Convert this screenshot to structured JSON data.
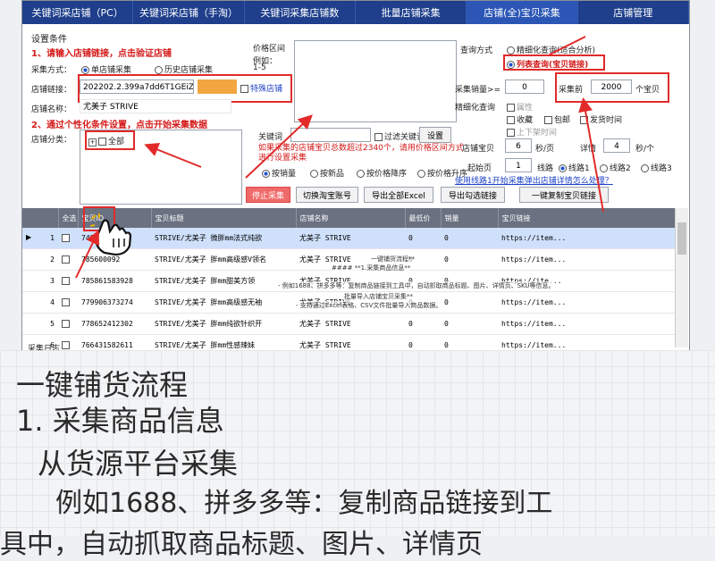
{
  "tabs": [
    "关键词采店铺（PC）",
    "关键词采店铺（手淘）",
    "关键词采集店铺数",
    "批量店铺采集",
    "店铺(全)宝贝采集",
    "店铺管理"
  ],
  "settings": {
    "title": "设置条件",
    "step1": "1、请输入店铺链接，点击验证店铺",
    "collect_method_label": "采集方式：",
    "single_shop": "单店铺采集",
    "history_shop": "历史店铺采集",
    "shop_link_label": "店铺链接：",
    "shop_link_value": "202202.2.399a7dd6T1GEiZ#/",
    "special_shop": "特殊店铺",
    "shop_name_label": "店铺名称：",
    "shop_name_value": "尤美子 STRIVE",
    "step2": "2、通过个性化条件设置，点击开始采集数据",
    "category_label": "店铺分类：",
    "category_all": "全部"
  },
  "price": {
    "label": "价格区间",
    "example": "例如：",
    "example_value": "1-5"
  },
  "keyword": {
    "label": "关键词",
    "filter": "过滤关键词",
    "set": "设置"
  },
  "warning": "如果采集的店铺宝贝总数超过2340个，请用价格区间方式进行设置采集",
  "sort": [
    "按销量",
    "按新品",
    "按价格降序",
    "按价格升序"
  ],
  "buttons": {
    "stop": "停止采集",
    "switch": "切换淘宝账号",
    "export_all": "导出全部Excel",
    "export_selected": "导出勾选链接",
    "copy_links": "一键复制宝贝链接"
  },
  "query": {
    "label": "查询方式",
    "fine": "精细化查询(适合分析)",
    "list": "列表查询(宝贝链接)",
    "volume_label": "采集销量>=",
    "volume_value": "0",
    "collect_before": "采集前",
    "collect_count": "2000",
    "unit": "个宝贝",
    "fine_label": "精细化查询",
    "attr": "属性",
    "favorite": "收藏",
    "free_ship": "包邮",
    "ship_time": "发货时间",
    "online": "上下架时间",
    "shop_baby": "店铺宝贝",
    "shop_baby_value": "6",
    "per_page": "秒/页",
    "detail": "详情",
    "detail_value": "4",
    "per_item": "秒/个",
    "start_page": "起始页",
    "start_page_value": "1",
    "line": "线路",
    "lines": [
      "线路1",
      "线路2",
      "线路3"
    ],
    "help_link": "使用线路1开始采集弹出店铺详情怎么处理？"
  },
  "table": {
    "headers": [
      "全选",
      "宝贝ID",
      "宝贝标题",
      "店铺名称",
      "最低价",
      "销量",
      "宝贝链接"
    ],
    "rows": [
      {
        "no": "1",
        "id": "7484810",
        "title": "STRIVE/尤美子 微胖mm法式纯欲",
        "shop": "尤美子 STRIVE",
        "price": "0",
        "sales": "0",
        "link": "https://item..."
      },
      {
        "no": "2",
        "id": "785600092",
        "title": "STRIVE/尤美子 胖mm高级感V领名",
        "shop": "尤美子 STRIVE",
        "price": "0",
        "sales": "0",
        "link": "https://item..."
      },
      {
        "no": "3",
        "id": "785861583928",
        "title": "STRIVE/尤美子 胖mm甜美方领",
        "shop": "尤美子 STRIVE",
        "price": "0",
        "sales": "0",
        "link": "https://ite..."
      },
      {
        "no": "4",
        "id": "779906373274",
        "title": "STRIVE/尤美子 胖mm高级感无袖",
        "shop": "尤美子 STRIVE",
        "price": "0",
        "sales": "0",
        "link": "https://item..."
      },
      {
        "no": "5",
        "id": "778652412302",
        "title": "STRIVE/尤美子 胖mm纯欲针织开",
        "shop": "尤美子 STRIVE",
        "price": "0",
        "sales": "0",
        "link": "https://item..."
      },
      {
        "no": "6",
        "id": "766431582611",
        "title": "STRIVE/尤美子 胖mm性感辣妹",
        "shop": "尤美子 STRIVE",
        "price": "0",
        "sales": "0",
        "link": "https://item..."
      }
    ]
  },
  "overlay": {
    "l1": "一键铺货流程**",
    "l2": "#### **1.采集商品信息**",
    "l3": "- 例如1688、拼多多等：复制商品链接到工具中，自动抓取商品标题、图片、详情页、SKU等信息。",
    "l4": "批量导入店铺宝贝采集**",
    "l5": "- 支持通过Excel表格、CSV文件批量导入商品数据。"
  },
  "log_label": "采集日志",
  "note": {
    "line1": "一键铺货流程",
    "line2": "1. 采集商品信息",
    "line3": "从货源平台采集",
    "line4": "例如1688、拼多多等：复制商品链接到工",
    "line5": "具中，自动抓取商品标题、图片、详情页"
  }
}
